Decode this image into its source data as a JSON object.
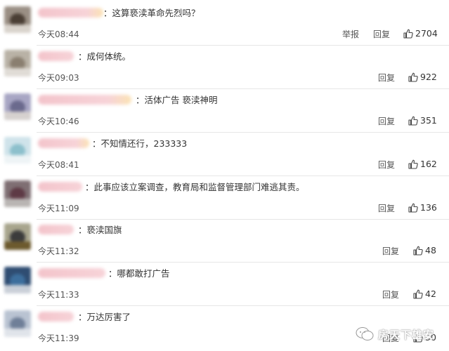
{
  "actions": {
    "report": "举报",
    "reply": "回复"
  },
  "comments": [
    {
      "text": "：这算亵渎革命先烈吗？",
      "time": "今天08:44",
      "likes": "2704",
      "report": true
    },
    {
      "text": "：成何体统。",
      "time": "今天09:03",
      "likes": "922"
    },
    {
      "text": "：活体广告 亵渎神明",
      "time": "今天10:46",
      "likes": "351"
    },
    {
      "text": "：不知情还行，233333",
      "time": "今天08:41",
      "likes": "162"
    },
    {
      "text": "：此事应该立案调查，教育局和监督管理部门难逃其责。",
      "time": "今天11:09",
      "likes": "136"
    },
    {
      "text": "：亵渎国旗",
      "time": "今天11:32",
      "likes": "48"
    },
    {
      "text": "：哪都敢打广告",
      "time": "今天11:33",
      "likes": "42"
    },
    {
      "text": "：万达厉害了",
      "time": "今天11:39",
      "likes": "30"
    }
  ],
  "watermark": {
    "text": "房天下雄安",
    "icon": "wechat-icon"
  },
  "colors": {
    "accent_name_pink": "#f5c9cf",
    "like_icon": "#444444",
    "divider": "#e6e6e6"
  }
}
